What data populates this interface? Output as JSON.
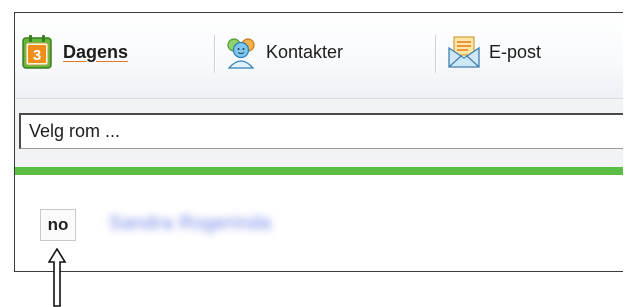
{
  "toolbar": {
    "items": [
      {
        "label": "Dagens",
        "icon": "calendar-icon",
        "active": true
      },
      {
        "label": "Kontakter",
        "icon": "contacts-icon",
        "active": false
      },
      {
        "label": "E-post",
        "icon": "email-icon",
        "active": false
      }
    ],
    "calendar_day": "3"
  },
  "room_select": {
    "value": "Velg rom ..."
  },
  "content": {
    "language_code": "no",
    "user_name": "Sandra Rogerinda"
  },
  "colors": {
    "accent_green": "#5cbf45",
    "active_underline": "#e07b1d",
    "link_blue": "#6c7fe6"
  }
}
